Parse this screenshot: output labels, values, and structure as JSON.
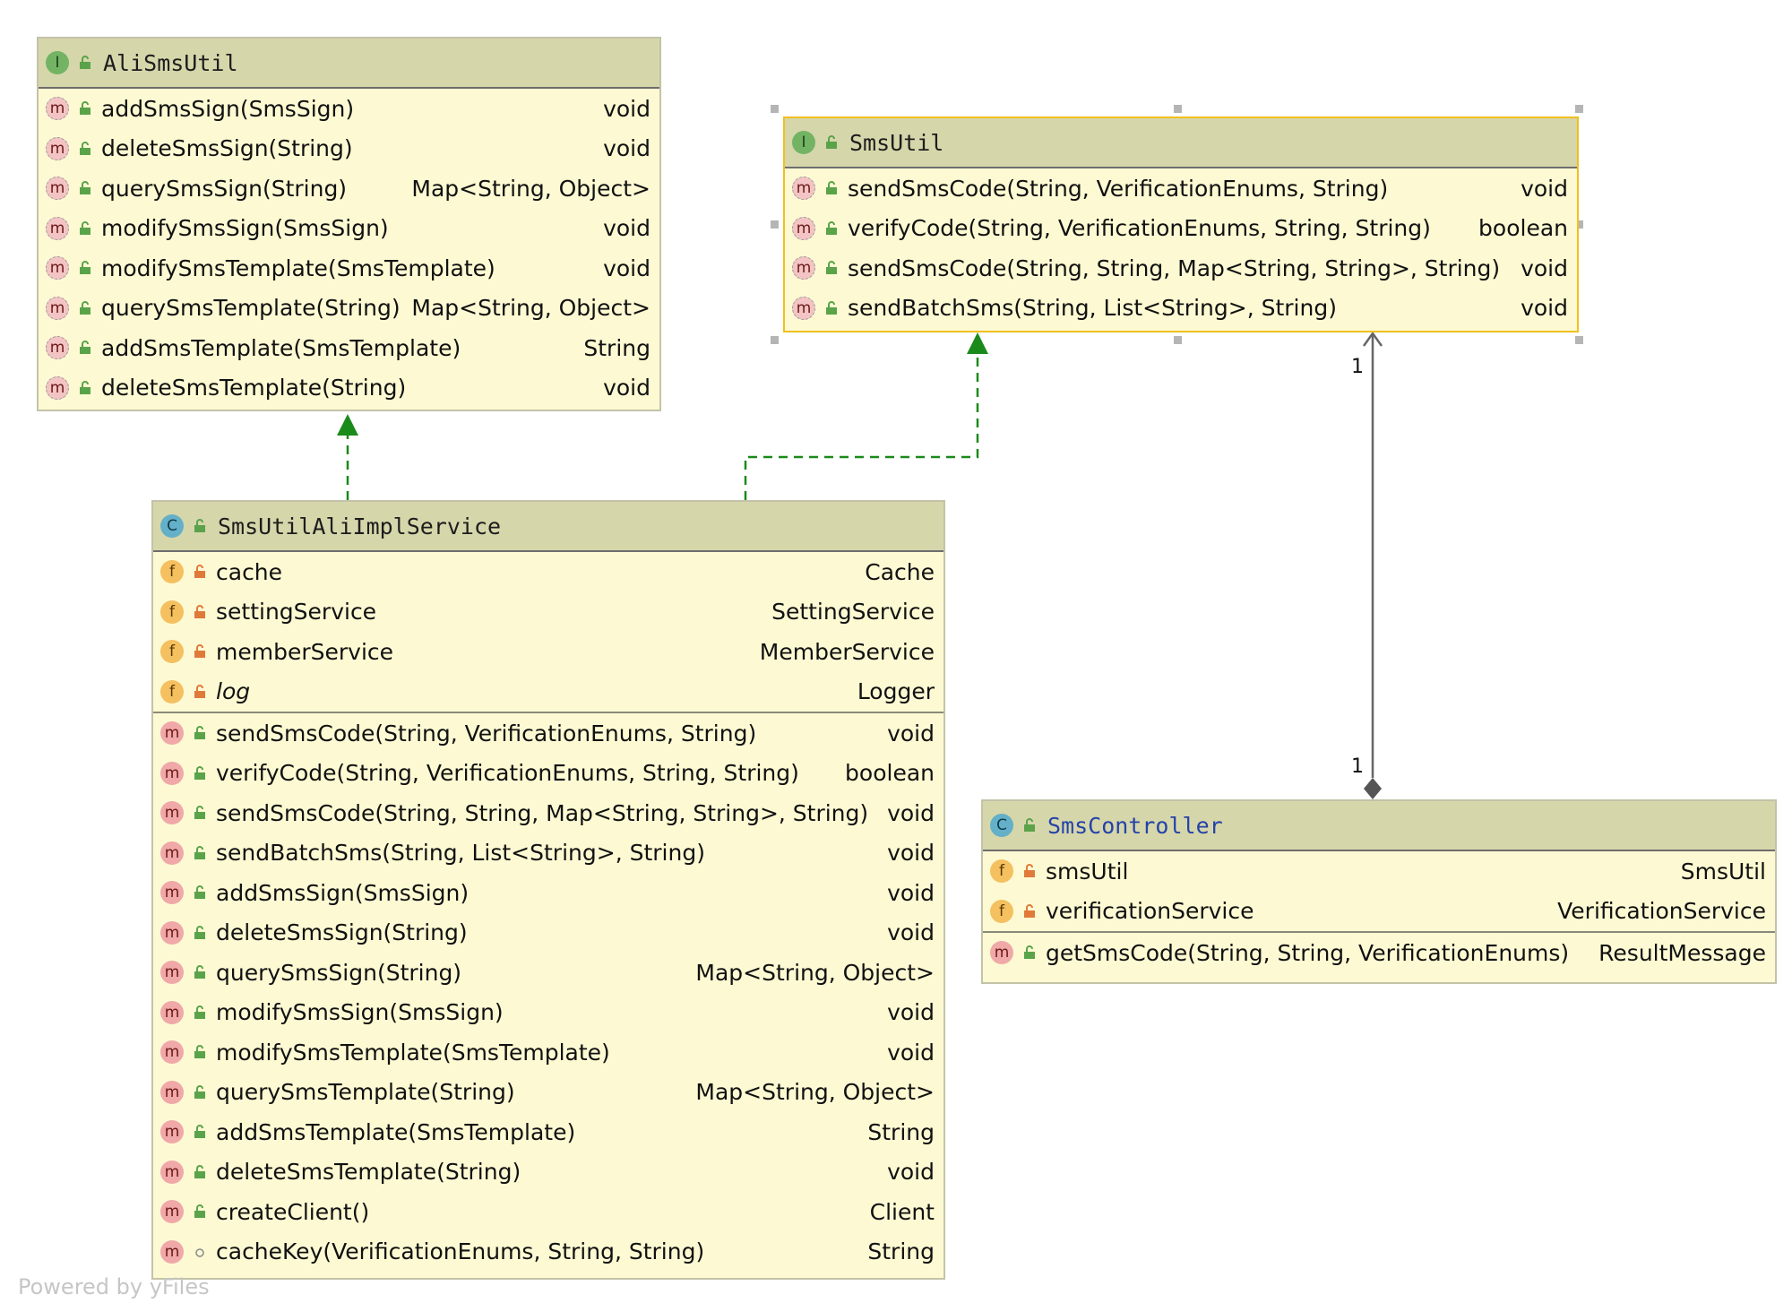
{
  "classes": {
    "alismsutil": {
      "name": "AliSmsUtil",
      "kind": "I",
      "methods": [
        {
          "label": "addSmsSign(SmsSign)",
          "type": "void"
        },
        {
          "label": "deleteSmsSign(String)",
          "type": "void"
        },
        {
          "label": "querySmsSign(String)",
          "type": "Map<String, Object>"
        },
        {
          "label": "modifySmsSign(SmsSign)",
          "type": "void"
        },
        {
          "label": "modifySmsTemplate(SmsTemplate)",
          "type": "void"
        },
        {
          "label": "querySmsTemplate(String)",
          "type": "Map<String, Object>"
        },
        {
          "label": "addSmsTemplate(SmsTemplate)",
          "type": "String"
        },
        {
          "label": "deleteSmsTemplate(String)",
          "type": "void"
        }
      ]
    },
    "smsutil": {
      "name": "SmsUtil",
      "kind": "I",
      "methods": [
        {
          "label": "sendSmsCode(String, VerificationEnums, String)",
          "type": "void"
        },
        {
          "label": "verifyCode(String, VerificationEnums, String, String)",
          "type": "boolean"
        },
        {
          "label": "sendSmsCode(String, String, Map<String, String>, String)",
          "type": "void"
        },
        {
          "label": "sendBatchSms(String, List<String>, String)",
          "type": "void"
        }
      ]
    },
    "impl": {
      "name": "SmsUtilAliImplService",
      "kind": "C",
      "fields": [
        {
          "label": "cache",
          "type": "Cache"
        },
        {
          "label": "settingService",
          "type": "SettingService"
        },
        {
          "label": "memberService",
          "type": "MemberService"
        },
        {
          "label": "log",
          "type": "Logger"
        }
      ],
      "methods": [
        {
          "label": "sendSmsCode(String, VerificationEnums, String)",
          "type": "void"
        },
        {
          "label": "verifyCode(String, VerificationEnums, String, String)",
          "type": "boolean"
        },
        {
          "label": "sendSmsCode(String, String, Map<String, String>, String)",
          "type": "void"
        },
        {
          "label": "sendBatchSms(String, List<String>, String)",
          "type": "void"
        },
        {
          "label": "addSmsSign(SmsSign)",
          "type": "void"
        },
        {
          "label": "deleteSmsSign(String)",
          "type": "void"
        },
        {
          "label": "querySmsSign(String)",
          "type": "Map<String, Object>"
        },
        {
          "label": "modifySmsSign(SmsSign)",
          "type": "void"
        },
        {
          "label": "modifySmsTemplate(SmsTemplate)",
          "type": "void"
        },
        {
          "label": "querySmsTemplate(String)",
          "type": "Map<String, Object>"
        },
        {
          "label": "addSmsTemplate(SmsTemplate)",
          "type": "String"
        },
        {
          "label": "deleteSmsTemplate(String)",
          "type": "void"
        },
        {
          "label": "createClient()",
          "type": "Client"
        },
        {
          "label": "cacheKey(VerificationEnums, String, String)",
          "type": "String"
        }
      ]
    },
    "controller": {
      "name": "SmsController",
      "kind": "C",
      "fields": [
        {
          "label": "smsUtil",
          "type": "SmsUtil"
        },
        {
          "label": "verificationService",
          "type": "VerificationService"
        }
      ],
      "methods": [
        {
          "label": "getSmsCode(String, String, VerificationEnums)",
          "type": "ResultMessage"
        }
      ]
    }
  },
  "badges": {
    "interface": "I",
    "class": "C",
    "method": "m",
    "field": "f"
  },
  "association": {
    "source_multiplicity": "1",
    "target_multiplicity": "1"
  },
  "footer": "Powered by yFiles",
  "colors": {
    "box_fill": "#fdfad3",
    "header_fill": "#d6d6ab",
    "selected_border": "#f0c020",
    "realization_edge": "#1a8a1a",
    "association_edge": "#666666"
  }
}
